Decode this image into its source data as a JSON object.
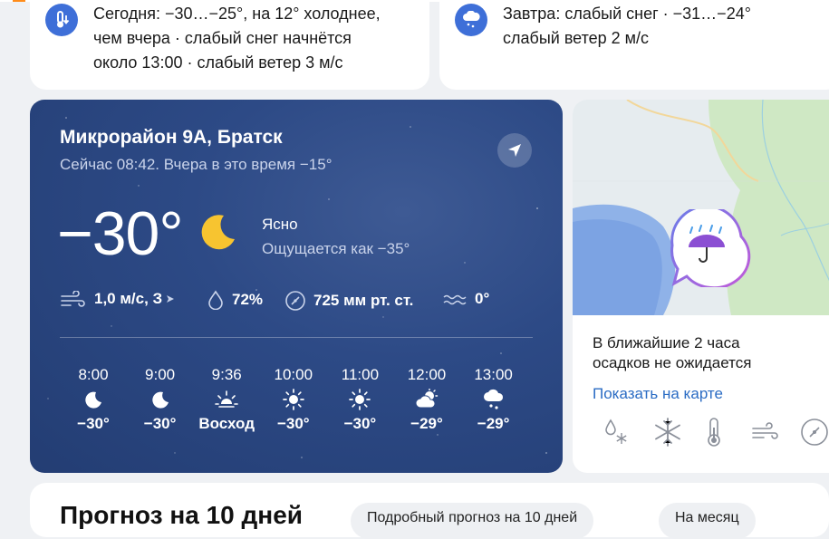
{
  "forecast_today": {
    "text_line1": "Сегодня: −30…−25°, на 12° холоднее,",
    "text_line2": "чем вчера · слабый снег начнётся",
    "text_line3": "около 13:00 · слабый ветер 3 м/с"
  },
  "forecast_tomorrow": {
    "text_line1": "Завтра: слабый снег · −31…−24°",
    "text_line2": "слабый ветер 2 м/с"
  },
  "current": {
    "location": "Микрорайон 9А, Братск",
    "subtitle": "Сейчас 08:42. Вчера в это время −15°",
    "temperature": "−30°",
    "condition": "Ясно",
    "feels_like": "Ощущается как −35°",
    "wind": "1,0 м/с, З",
    "humidity": "72%",
    "pressure": "725 мм рт. ст.",
    "water_temp": "0°"
  },
  "hourly": [
    {
      "time": "8:00",
      "icon": "moon-icon",
      "value": "−30°"
    },
    {
      "time": "9:00",
      "icon": "moon-icon",
      "value": "−30°"
    },
    {
      "time": "9:36",
      "icon": "sunrise-icon",
      "value": "Восход"
    },
    {
      "time": "10:00",
      "icon": "sun-icon",
      "value": "−30°"
    },
    {
      "time": "11:00",
      "icon": "sun-icon",
      "value": "−30°"
    },
    {
      "time": "12:00",
      "icon": "partly-cloudy-icon",
      "value": "−29°"
    },
    {
      "time": "13:00",
      "icon": "snow-cloud-icon",
      "value": "−29°"
    }
  ],
  "nowcast": {
    "line1": "В ближайшие 2 часа",
    "line2": "осадков не ожидается",
    "link": "Показать на карте",
    "legend_icons": [
      "rain-snow-icon",
      "snowflake-icon",
      "thermometer-icon",
      "wind-icon",
      "pressure-icon"
    ]
  },
  "bottom": {
    "title": "Прогноз на 10 дней",
    "pill1": "Подробный прогноз на 10 дней",
    "pill2": "На месяц"
  },
  "colors": {
    "accent_blue": "#3e6fd8",
    "link": "#2b6cc4",
    "card_bg": "#2d4a86"
  }
}
